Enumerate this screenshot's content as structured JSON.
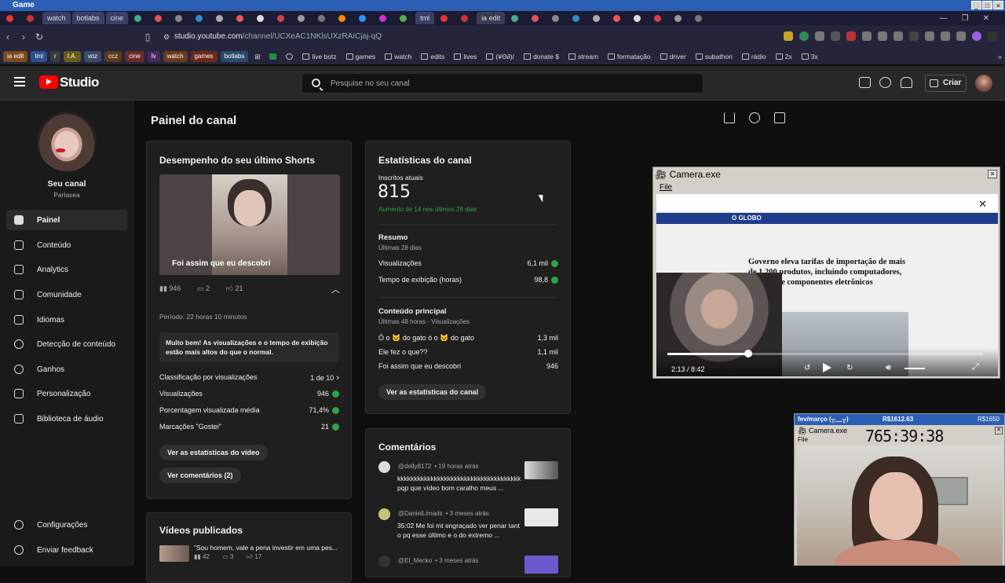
{
  "window": {
    "title": "Game"
  },
  "tabs": {
    "named": [
      "watch",
      "botlabs",
      "cine",
      "tml",
      "ia edit"
    ],
    "unnamed_count": 28
  },
  "address": {
    "url_host": "studio.youtube.com",
    "url_path": "/channel/UCXeAC1NKlsUXzRAICjaj-qQ"
  },
  "bookmarks": {
    "pills": [
      "ia edit",
      "tml",
      "r",
      "I.A.",
      "voz",
      "ccz",
      "cine",
      "lv",
      "watch",
      "games",
      "botlabs"
    ],
    "folders": [
      "live botz",
      "games",
      "watch",
      "edits",
      "lives",
      "(¥Θ∂)/",
      "donate $",
      "stream",
      "formatação",
      "driver",
      "subathon",
      "rádio",
      "2x",
      "3x"
    ]
  },
  "header": {
    "app_name": "Studio",
    "search_placeholder": "Pesquise no seu canal",
    "create_label": "Criar"
  },
  "sidebar": {
    "channel_title": "Seu canal",
    "channel_handle": "Parlasea",
    "items": [
      {
        "label": "Painel"
      },
      {
        "label": "Conteúdo"
      },
      {
        "label": "Analytics"
      },
      {
        "label": "Comunidade"
      },
      {
        "label": "Idiomas"
      },
      {
        "label": "Detecção de conteúdo"
      },
      {
        "label": "Ganhos"
      },
      {
        "label": "Personalização"
      },
      {
        "label": "Biblioteca de áudio"
      }
    ],
    "bottom": [
      {
        "label": "Configurações"
      },
      {
        "label": "Enviar feedback"
      }
    ]
  },
  "main": {
    "title": "Painel do canal",
    "shorts": {
      "title": "Desempenho do seu último Shorts",
      "thumb_caption": "Foi assim que eu descobri",
      "views": "946",
      "comments": "2",
      "likes": "21",
      "period": "Período: 22 horas 10 minutos",
      "message": "Muito bem! As visualizações e o tempo de exibição estão mais altos do que o normal.",
      "rows": [
        {
          "label": "Classificação por visualizações",
          "value": "1 de 10"
        },
        {
          "label": "Visualizações",
          "value": "946"
        },
        {
          "label": "Porcentagem visualizada média",
          "value": "71,4%"
        },
        {
          "label": "Marcações \"Gostei\"",
          "value": "21"
        }
      ],
      "btn_stats": "Ver as estatísticas do vídeo",
      "btn_comments": "Ver comentários (2)"
    },
    "stats": {
      "title": "Estatísticas do canal",
      "subs_label": "Inscritos atuais",
      "subs_value": "815",
      "subs_change": "Aumento de 14 nos últimos 28 dias",
      "summary_title": "Resumo",
      "summary_period": "Últimas 28 dias",
      "summary_rows": [
        {
          "label": "Visualizações",
          "value": "6,1 mil"
        },
        {
          "label": "Tempo de exibição (horas)",
          "value": "98,8"
        }
      ],
      "top_title": "Conteúdo principal",
      "top_period": "Últimas 48 horas · Visualizações",
      "top_rows": [
        {
          "label": "Ó o 🐱 do gato ó o 🐱 do gato",
          "value": "1,3 mil"
        },
        {
          "label": "Ele fez o que??",
          "value": "1,1 mil"
        },
        {
          "label": "Foi assim que eu descobri",
          "value": "946"
        }
      ],
      "btn": "Ver as estatísticas do canal"
    },
    "comments": {
      "title": "Comentários",
      "items": [
        {
          "author": "@delly8172",
          "time": "• 19 horas atrás",
          "text": "kkkkkkkkkkkkkkkkkkkkkkkkkkkkkkkkkkkkk pqp que vídeo bom caralho meus ..."
        },
        {
          "author": "@DanielLimads",
          "time": "• 3 meses atrás",
          "text": "35:02 Me foi mt engraçado ver penar tanto pq esse último e o do extremo ..."
        },
        {
          "author": "@El_Mecko",
          "time": "• 3 meses atrás",
          "text": ""
        }
      ]
    },
    "videos": {
      "title": "Vídeos publicados",
      "first_title": "\"Sou homem, vale a pena investir em uma pes...",
      "first_views": "42",
      "first_comments": "3",
      "first_likes": "17"
    }
  },
  "camera1": {
    "title": "Camera.exe",
    "menu": "File",
    "headline": "Governo eleva tarifas de importação de mais de 1.200 produtos, incluindo computadores, celulares e componentes eletrônicos",
    "site": "O GLOBO",
    "time": "2:13 / 8:42",
    "progress": 0.255
  },
  "camera2": {
    "bar_left": "fev/março (╥﹏╥)",
    "bar_mid": "R$1612.63",
    "bar_right": "R$1650",
    "title": "Camera.exe",
    "menu": "File",
    "counter": "765:39:38"
  }
}
